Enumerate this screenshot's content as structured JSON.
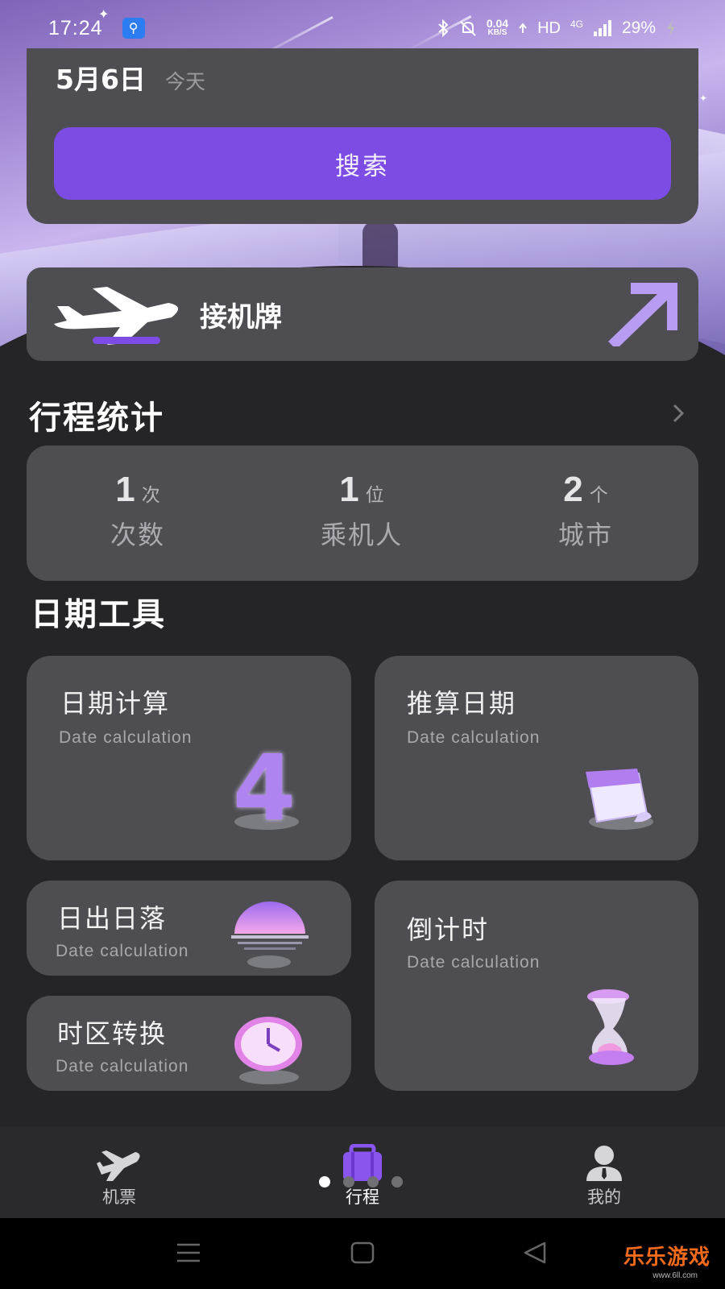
{
  "status_bar": {
    "time": "17:24",
    "speed_value": "0.04",
    "speed_unit": "KB/S",
    "network": "HD",
    "signal": "4G",
    "battery": "29%",
    "icons": [
      "usb-icon",
      "bluetooth-icon",
      "mute-icon",
      "wifi-icon",
      "signal-icon",
      "charging-icon"
    ]
  },
  "date_card": {
    "date": "5月6日",
    "relative": "今天",
    "search_label": "搜索"
  },
  "pickup": {
    "label": "接机牌"
  },
  "trip_stats": {
    "title": "行程统计",
    "items": [
      {
        "value": "1",
        "unit": "次",
        "label": "次数"
      },
      {
        "value": "1",
        "unit": "位",
        "label": "乘机人"
      },
      {
        "value": "2",
        "unit": "个",
        "label": "城市"
      }
    ]
  },
  "date_tools": {
    "title": "日期工具",
    "items": [
      {
        "title": "日期计算",
        "subtitle": "Date calculation",
        "deco_text": "4"
      },
      {
        "title": "推算日期",
        "subtitle": "Date calculation"
      },
      {
        "title": "日出日落",
        "subtitle": "Date calculation"
      },
      {
        "title": "倒计时",
        "subtitle": "Date calculation"
      },
      {
        "title": "时区转换",
        "subtitle": "Date calculation"
      }
    ]
  },
  "bottom_nav": {
    "items": [
      {
        "label": "机票",
        "icon": "airplane-icon"
      },
      {
        "label": "行程",
        "icon": "suitcase-icon"
      },
      {
        "label": "我的",
        "icon": "user-icon"
      }
    ],
    "active_index": 1
  },
  "watermark": {
    "text": "乐乐游戏",
    "sub": "www.6ll.com"
  },
  "colors": {
    "accent": "#7c4ce4",
    "card": "#4e4e52",
    "background": "#252528"
  }
}
